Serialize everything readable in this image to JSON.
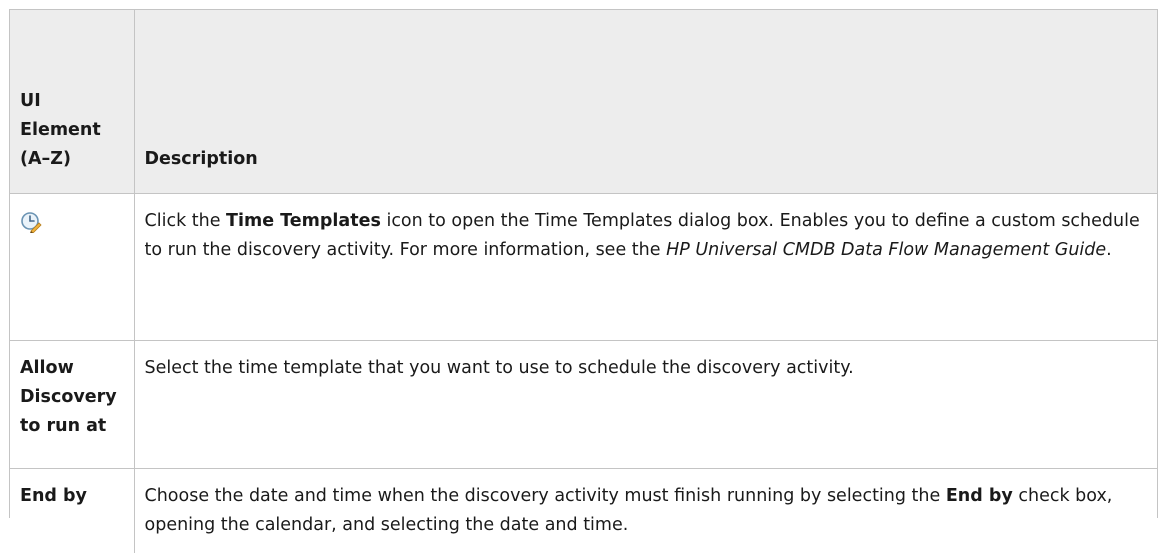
{
  "table": {
    "headers": {
      "element": "UI Element (A–Z)",
      "description": "Description"
    },
    "rows": [
      {
        "icon": "time-templates-icon",
        "description": {
          "part1": "Click the ",
          "bold1": "Time Templates",
          "part2": " icon to open the Time Templates dialog box. Enables you to define a custom schedule to run the discovery activity. For more information, see the ",
          "italic1": "HP Universal CMDB Data Flow Management Guide",
          "part3": "."
        }
      },
      {
        "element": "Allow Discovery to run at",
        "description": "Select the time template that you want to use to schedule the discovery activity."
      },
      {
        "element": "End by",
        "description": {
          "part1": "Choose the date and time when the discovery activity must finish running by selecting the ",
          "bold1": "End by",
          "part2": " check box, opening the calendar, and selecting the date and time."
        }
      }
    ]
  },
  "colors": {
    "header_bg": "#ededed",
    "border": "#c4c4c4",
    "text": "#1a1a1a"
  }
}
